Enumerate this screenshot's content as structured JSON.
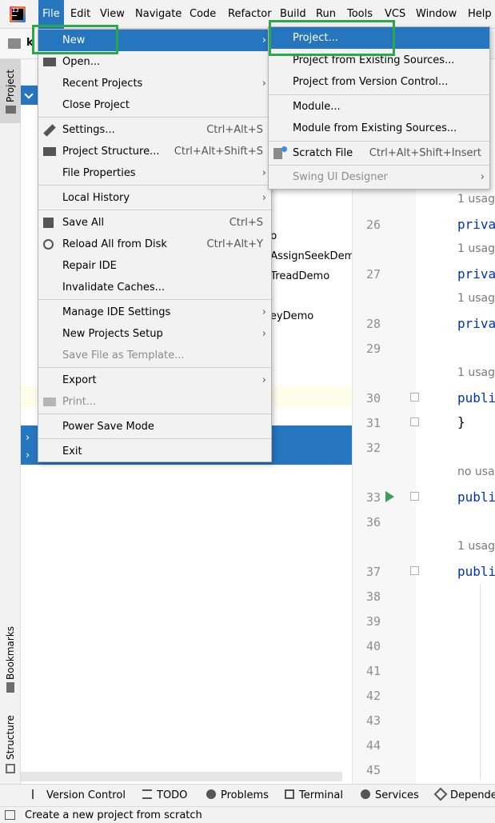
{
  "menubar": {
    "items": [
      "File",
      "Edit",
      "View",
      "Navigate",
      "Code",
      "Refactor",
      "Build",
      "Run",
      "Tools",
      "VCS",
      "Window",
      "Help"
    ]
  },
  "toolbar": {
    "project_name_partial": "k"
  },
  "left_strip": {
    "project": "Project",
    "bookmarks": "Bookmarks",
    "structure": "Structure"
  },
  "project_tree": {
    "items": [
      "no",
      "nAssignSeekDem",
      "nTreadDemo",
      "o",
      "KeyDemo"
    ]
  },
  "file_menu": {
    "items": [
      {
        "label": "New",
        "shortcut": "",
        "submenu": true
      },
      {
        "label": "Open...",
        "shortcut": "",
        "submenu": false
      },
      {
        "label": "Recent Projects",
        "shortcut": "",
        "submenu": true
      },
      {
        "label": "Close Project",
        "shortcut": "",
        "submenu": false
      },
      {
        "label": "Settings...",
        "shortcut": "Ctrl+Alt+S",
        "submenu": false
      },
      {
        "label": "Project Structure...",
        "shortcut": "Ctrl+Alt+Shift+S",
        "submenu": false
      },
      {
        "label": "File Properties",
        "shortcut": "",
        "submenu": true
      },
      {
        "label": "Local History",
        "shortcut": "",
        "submenu": true
      },
      {
        "label": "Save All",
        "shortcut": "Ctrl+S",
        "submenu": false
      },
      {
        "label": "Reload All from Disk",
        "shortcut": "Ctrl+Alt+Y",
        "submenu": false
      },
      {
        "label": "Repair IDE",
        "shortcut": "",
        "submenu": false
      },
      {
        "label": "Invalidate Caches...",
        "shortcut": "",
        "submenu": false
      },
      {
        "label": "Manage IDE Settings",
        "shortcut": "",
        "submenu": true
      },
      {
        "label": "New Projects Setup",
        "shortcut": "",
        "submenu": true
      },
      {
        "label": "Save File as Template...",
        "shortcut": "",
        "submenu": false
      },
      {
        "label": "Export",
        "shortcut": "",
        "submenu": true
      },
      {
        "label": "Print...",
        "shortcut": "",
        "submenu": false
      },
      {
        "label": "Power Save Mode",
        "shortcut": "",
        "submenu": false
      },
      {
        "label": "Exit",
        "shortcut": "",
        "submenu": false
      }
    ]
  },
  "new_submenu": {
    "items": [
      {
        "label": "Project...",
        "shortcut": ""
      },
      {
        "label": "Project from Existing Sources...",
        "shortcut": ""
      },
      {
        "label": "Project from Version Control...",
        "shortcut": ""
      },
      {
        "label": "Module...",
        "shortcut": ""
      },
      {
        "label": "Module from Existing Sources...",
        "shortcut": ""
      },
      {
        "label": "Scratch File",
        "shortcut": "Ctrl+Alt+Shift+Insert"
      },
      {
        "label": "Swing UI Designer",
        "shortcut": ""
      }
    ]
  },
  "editor": {
    "line_numbers": [
      "26",
      "27",
      "28",
      "29",
      "30",
      "31",
      "32",
      "33",
      "36",
      "37",
      "38",
      "39",
      "40",
      "41",
      "42",
      "43",
      "44",
      "45"
    ],
    "hints": [
      "1 usag",
      "1 usag",
      "1 usag",
      "1 usag",
      "no usa",
      "1 usag"
    ],
    "code": [
      "priva",
      "priva",
      "priva",
      "publi",
      "}",
      "publi",
      "publi"
    ]
  },
  "bottom_tools": [
    "Version Control",
    "TODO",
    "Problems",
    "Terminal",
    "Services",
    "Depender"
  ],
  "status": {
    "text": "Create a new project from scratch"
  },
  "colors": {
    "highlight": "#2675bf",
    "annotation": "#2ba84a",
    "keyword": "#0033b3"
  }
}
